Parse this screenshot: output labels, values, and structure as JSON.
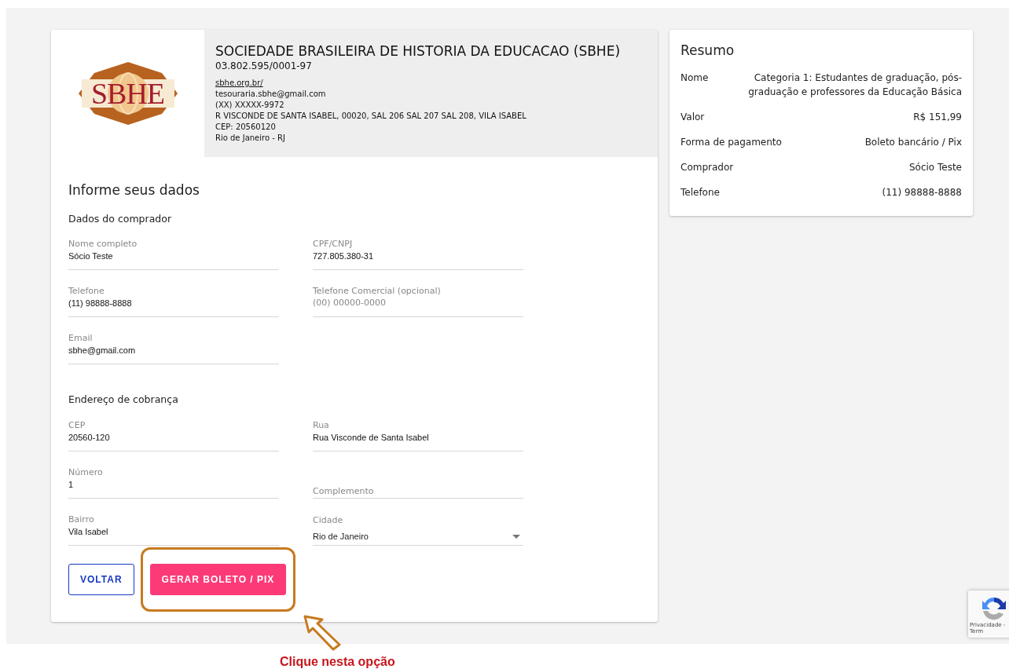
{
  "org": {
    "logo": "SBHE",
    "name": "SOCIEDADE BRASILEIRA DE HISTORIA DA EDUCACAO (SBHE)",
    "cnpj": "03.802.595/0001-97",
    "site": "sbhe.org.br/",
    "details": [
      "tesouraria.sbhe@gmail.com",
      "(XX) XXXXX-9972",
      "R VISCONDE DE SANTA ISABEL, 00020, SAL 206 SAL 207 SAL 208, VILA ISABEL",
      "CEP: 20560120",
      "Rio de Janeiro - RJ"
    ]
  },
  "form": {
    "title": "Informe seus dados",
    "sections": [
      {
        "title": "Dados do comprador",
        "rows": [
          [
            {
              "kind": "text",
              "label": "Nome completo",
              "value": "Sócio Teste"
            },
            {
              "kind": "text",
              "label": "CPF/CNPJ",
              "value": "727.805.380-31"
            }
          ],
          [
            {
              "kind": "text",
              "label": "Telefone",
              "value": "(11) 98888-8888"
            },
            {
              "kind": "text",
              "label": "Telefone Comercial (opcional)",
              "placeholder": "(00) 00000-0000"
            }
          ],
          [
            {
              "kind": "text",
              "label": "Email",
              "value": "sbhe@gmail.com"
            }
          ]
        ]
      },
      {
        "title": "Endereço de cobrança",
        "rows": [
          [
            {
              "kind": "text",
              "label": "CEP",
              "value": "20560-120"
            },
            {
              "kind": "text",
              "label": "Rua",
              "value": "Rua Visconde de Santa Isabel"
            }
          ],
          [
            {
              "kind": "text",
              "label": "Número",
              "value": "1"
            },
            {
              "kind": "empty",
              "label": "Complemento"
            }
          ],
          [
            {
              "kind": "text",
              "label": "Bairro",
              "value": "Vila Isabel"
            },
            {
              "kind": "select",
              "label": "Cidade",
              "value": "Rio de Janeiro"
            }
          ]
        ]
      }
    ],
    "buttons": [
      {
        "kind": "outline",
        "label": "VOLTAR"
      },
      {
        "kind": "primary",
        "label": "GERAR BOLETO / PIX",
        "highlighted": true
      }
    ]
  },
  "summary": {
    "title": "Resumo",
    "rows": [
      {
        "label": "Nome",
        "value": "Categoria 1: Estudantes de graduação, pós-graduação e professores da Educação Básica"
      },
      {
        "label": "Valor",
        "value": "R$ 151,99"
      },
      {
        "label": "Forma de pagamento",
        "value": "Boleto bancário / Pix"
      },
      {
        "label": "Comprador",
        "value": "Sócio Teste"
      },
      {
        "label": "Telefone",
        "value": "(11) 98888-8888"
      }
    ]
  },
  "recaptcha": {
    "text": "Privacidade - Term"
  },
  "annotation": {
    "text": "Clique nesta opção"
  }
}
